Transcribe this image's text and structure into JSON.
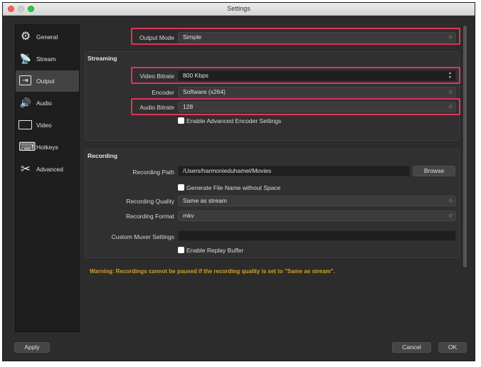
{
  "window": {
    "title": "Settings"
  },
  "sidebar": {
    "items": [
      {
        "label": "General",
        "icon": "gear-icon",
        "glyph": "⚙"
      },
      {
        "label": "Stream",
        "icon": "antenna-icon",
        "glyph": "📡"
      },
      {
        "label": "Output",
        "icon": "output-icon",
        "glyph": "⇥"
      },
      {
        "label": "Audio",
        "icon": "speaker-icon",
        "glyph": "🔊"
      },
      {
        "label": "Video",
        "icon": "monitor-icon",
        "glyph": "🖵"
      },
      {
        "label": "Hotkeys",
        "icon": "keyboard-icon",
        "glyph": "⌨"
      },
      {
        "label": "Advanced",
        "icon": "tools-icon",
        "glyph": "✂"
      }
    ],
    "active": "Output"
  },
  "output": {
    "mode_label": "Output Mode",
    "mode_value": "Simple"
  },
  "streaming": {
    "title": "Streaming",
    "video_bitrate_label": "Video Bitrate",
    "video_bitrate_value": "800 Kbps",
    "encoder_label": "Encoder",
    "encoder_value": "Software (x264)",
    "audio_bitrate_label": "Audio Bitrate",
    "audio_bitrate_value": "128",
    "advanced_encoder_label": "Enable Advanced Encoder Settings"
  },
  "recording": {
    "title": "Recording",
    "path_label": "Recording Path",
    "path_value": "/Users/harmonieduhamel/Movies",
    "browse_label": "Browse",
    "no_space_label": "Generate File Name without Space",
    "quality_label": "Recording Quality",
    "quality_value": "Same as stream",
    "format_label": "Recording Format",
    "format_value": "mkv",
    "muxer_label": "Custom Muxer Settings",
    "muxer_value": "",
    "replay_label": "Enable Replay Buffer"
  },
  "warning": "Warning: Recordings cannot be paused if the recording quality is set to \"Same as stream\".",
  "footer": {
    "apply": "Apply",
    "cancel": "Cancel",
    "ok": "OK"
  },
  "colors": {
    "highlight": "#e2335e",
    "warning": "#d4a11f",
    "active_nav": "#434343"
  }
}
